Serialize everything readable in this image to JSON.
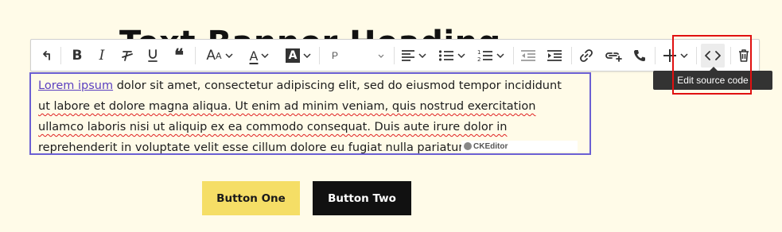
{
  "banner": {
    "heading": "Text Banner Heading"
  },
  "toolbar": {
    "heading_select_value": "P",
    "tooltip": "Edit source code",
    "items": [
      {
        "name": "undo-icon"
      },
      {
        "name": "bold-icon"
      },
      {
        "name": "italic-icon"
      },
      {
        "name": "remove-format-icon"
      },
      {
        "name": "underline-icon"
      },
      {
        "name": "blockquote-icon"
      },
      {
        "name": "font-size-icon"
      },
      {
        "name": "font-color-icon"
      },
      {
        "name": "font-background-color-icon"
      },
      {
        "name": "heading-select"
      },
      {
        "name": "alignment-icon"
      },
      {
        "name": "bulleted-list-icon"
      },
      {
        "name": "numbered-list-icon"
      },
      {
        "name": "outdent-icon"
      },
      {
        "name": "indent-icon"
      },
      {
        "name": "link-icon"
      },
      {
        "name": "add-link-icon"
      },
      {
        "name": "phone-icon"
      },
      {
        "name": "insert-plus-icon"
      },
      {
        "name": "source-code-icon"
      },
      {
        "name": "trash-icon"
      }
    ]
  },
  "editor": {
    "link_text": "Lorem ipsum",
    "line1_rest": " dolor sit amet, consectetur adipiscing elit, sed do eiusmod tempor incididunt",
    "line2": "ut labore et dolore magna aliqua. Ut enim ad minim veniam, quis nostrud exercitation",
    "line3": "ullamco laboris nisi ut aliquip ex ea commodo consequat. Duis aute irure dolor in",
    "line4": "reprehenderit in voluptate velit esse cillum dolore eu fugiat nulla pariatur",
    "powered_by": "CKEditor"
  },
  "buttons": {
    "one_label": "Button One",
    "two_label": "Button Two"
  },
  "colors": {
    "page_bg": "#fffbe8",
    "editor_focus_border": "#6b5fd3",
    "button_one_bg": "#f5de66",
    "button_two_bg": "#111111",
    "highlight": "#e01010"
  }
}
